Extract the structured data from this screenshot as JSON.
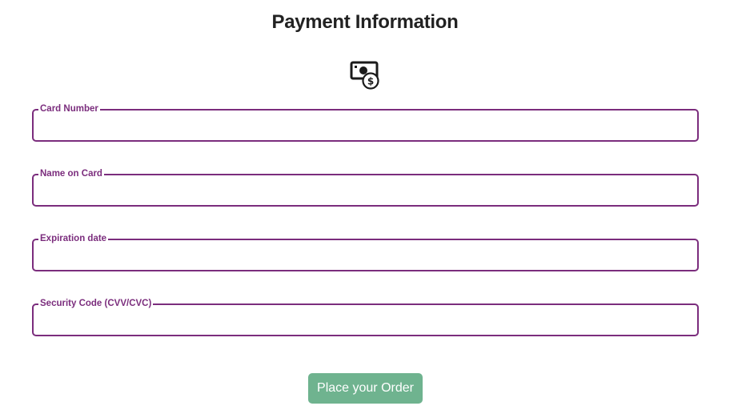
{
  "header": {
    "title": "Payment Information",
    "icon": "money-icon"
  },
  "form": {
    "fields": [
      {
        "label": "Card Number",
        "value": "",
        "placeholder": ""
      },
      {
        "label": "Name on Card",
        "value": "",
        "placeholder": ""
      },
      {
        "label": "Expiration date",
        "value": "",
        "placeholder": ""
      },
      {
        "label": "Security Code (CVV/CVC)",
        "value": "",
        "placeholder": ""
      }
    ],
    "submit_label": "Place your Order"
  },
  "colors": {
    "accent": "#7b2d7d",
    "button": "#6fb38f",
    "title": "#222222"
  }
}
